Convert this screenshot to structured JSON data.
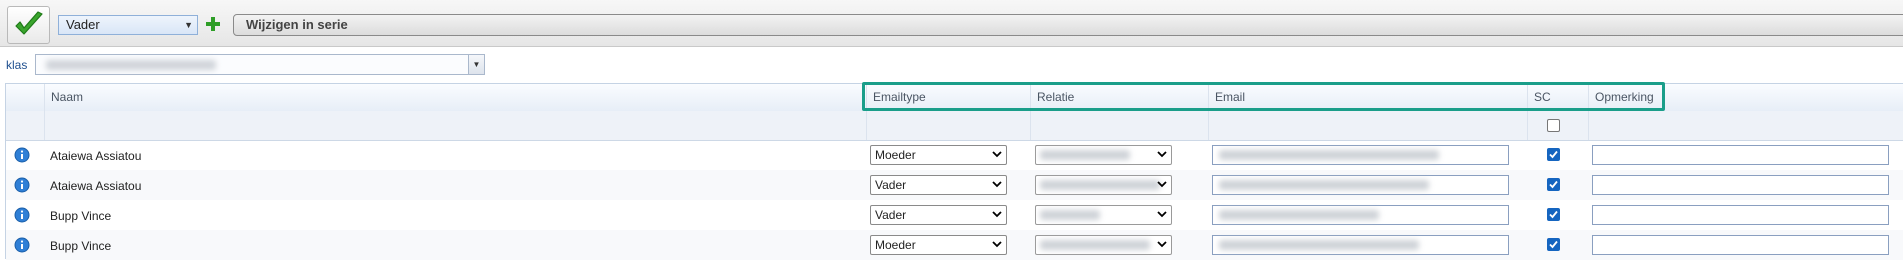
{
  "toolbar": {
    "role_select_value": "Vader",
    "series_label": "Wijzigen in serie",
    "confirm_color": "#3aa52d",
    "add_color": "#2e9e27"
  },
  "filter": {
    "klas_label": "klas"
  },
  "grid": {
    "columns": [
      "Naam",
      "Emailtype",
      "Relatie",
      "Email",
      "SC",
      "Opmerking"
    ],
    "rows": [
      {
        "name": "Ataiewa Assiatou",
        "emailtype": "Moeder",
        "sc_checked": true
      },
      {
        "name": "Ataiewa Assiatou",
        "emailtype": "Vader",
        "sc_checked": true
      },
      {
        "name": "Bupp Vince",
        "emailtype": "Vader",
        "sc_checked": true
      },
      {
        "name": "Bupp Vince",
        "emailtype": "Moeder",
        "sc_checked": true
      }
    ],
    "highlight_color": "#1a9e8a",
    "checkbox_color": "#1565c0"
  }
}
